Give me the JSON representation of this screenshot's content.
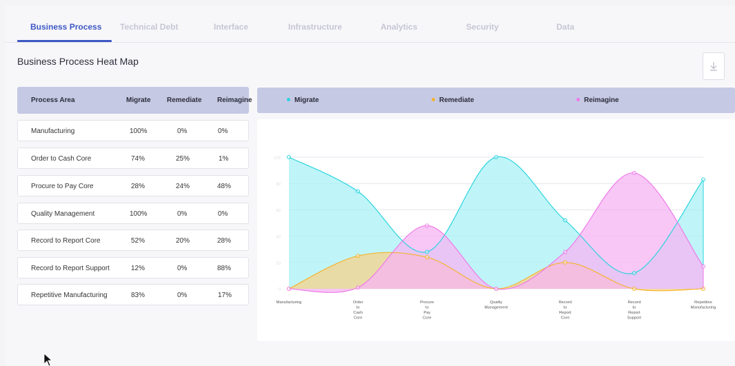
{
  "tabs": [
    {
      "label": "Business Process",
      "active": true
    },
    {
      "label": "Technical Debt",
      "active": false
    },
    {
      "label": "Interface",
      "active": false
    },
    {
      "label": "Infrastructure",
      "active": false
    },
    {
      "label": "Analytics",
      "active": false
    },
    {
      "label": "Security",
      "active": false
    },
    {
      "label": "Data",
      "active": false
    }
  ],
  "page_title": "Business Process Heat Map",
  "download_icon": "download-icon",
  "table": {
    "headers": [
      "Process Area",
      "Migrate",
      "Remediate",
      "Reimagine"
    ],
    "rows": [
      {
        "area": "Manufacturing",
        "migrate": "100%",
        "remediate": "0%",
        "reimagine": "0%"
      },
      {
        "area": "Order to Cash Core",
        "migrate": "74%",
        "remediate": "25%",
        "reimagine": "1%"
      },
      {
        "area": "Procure to Pay Core",
        "migrate": "28%",
        "remediate": "24%",
        "reimagine": "48%"
      },
      {
        "area": "Quality Management",
        "migrate": "100%",
        "remediate": "0%",
        "reimagine": "0%"
      },
      {
        "area": "Record to Report Core",
        "migrate": "52%",
        "remediate": "20%",
        "reimagine": "28%"
      },
      {
        "area": "Record to Report Support",
        "migrate": "12%",
        "remediate": "0%",
        "reimagine": "88%"
      },
      {
        "area": "Repetitive Manufacturing",
        "migrate": "83%",
        "remediate": "0%",
        "reimagine": "17%"
      }
    ]
  },
  "legend": [
    {
      "label": "Migrate",
      "color": "#2ad4de"
    },
    {
      "label": "Remediate",
      "color": "#f6b330"
    },
    {
      "label": "Reimagine",
      "color": "#ee7ae9"
    }
  ],
  "chart_data": {
    "type": "area",
    "categories": [
      [
        "Manufacturing"
      ],
      [
        "Order",
        "to",
        "Cash",
        "Core"
      ],
      [
        "Procure",
        "to",
        "Pay",
        "Core"
      ],
      [
        "Quality",
        "Management"
      ],
      [
        "Record",
        "to",
        "Report",
        "Core"
      ],
      [
        "Record",
        "to",
        "Report",
        "Support"
      ],
      [
        "Repetitive",
        "Manufacturing"
      ]
    ],
    "yticks": [
      0,
      20,
      40,
      60,
      80,
      100
    ],
    "ylim": [
      0,
      100
    ],
    "grid": true,
    "smooth": true,
    "series": [
      {
        "name": "Migrate",
        "values": [
          100,
          74,
          28,
          100,
          52,
          12,
          83
        ],
        "color": "#2ad4de",
        "fill": "#a9f2f5"
      },
      {
        "name": "Remediate",
        "values": [
          0,
          25,
          24,
          0,
          20,
          0,
          0
        ],
        "color": "#f6b330",
        "fill": "#f7d28a"
      },
      {
        "name": "Reimagine",
        "values": [
          0,
          1,
          48,
          0,
          28,
          88,
          17
        ],
        "color": "#ee7ae9",
        "fill": "#f6b4f3"
      }
    ]
  },
  "colors": {
    "accent": "#3d58c4",
    "header_bg": "#c5c9e4"
  }
}
